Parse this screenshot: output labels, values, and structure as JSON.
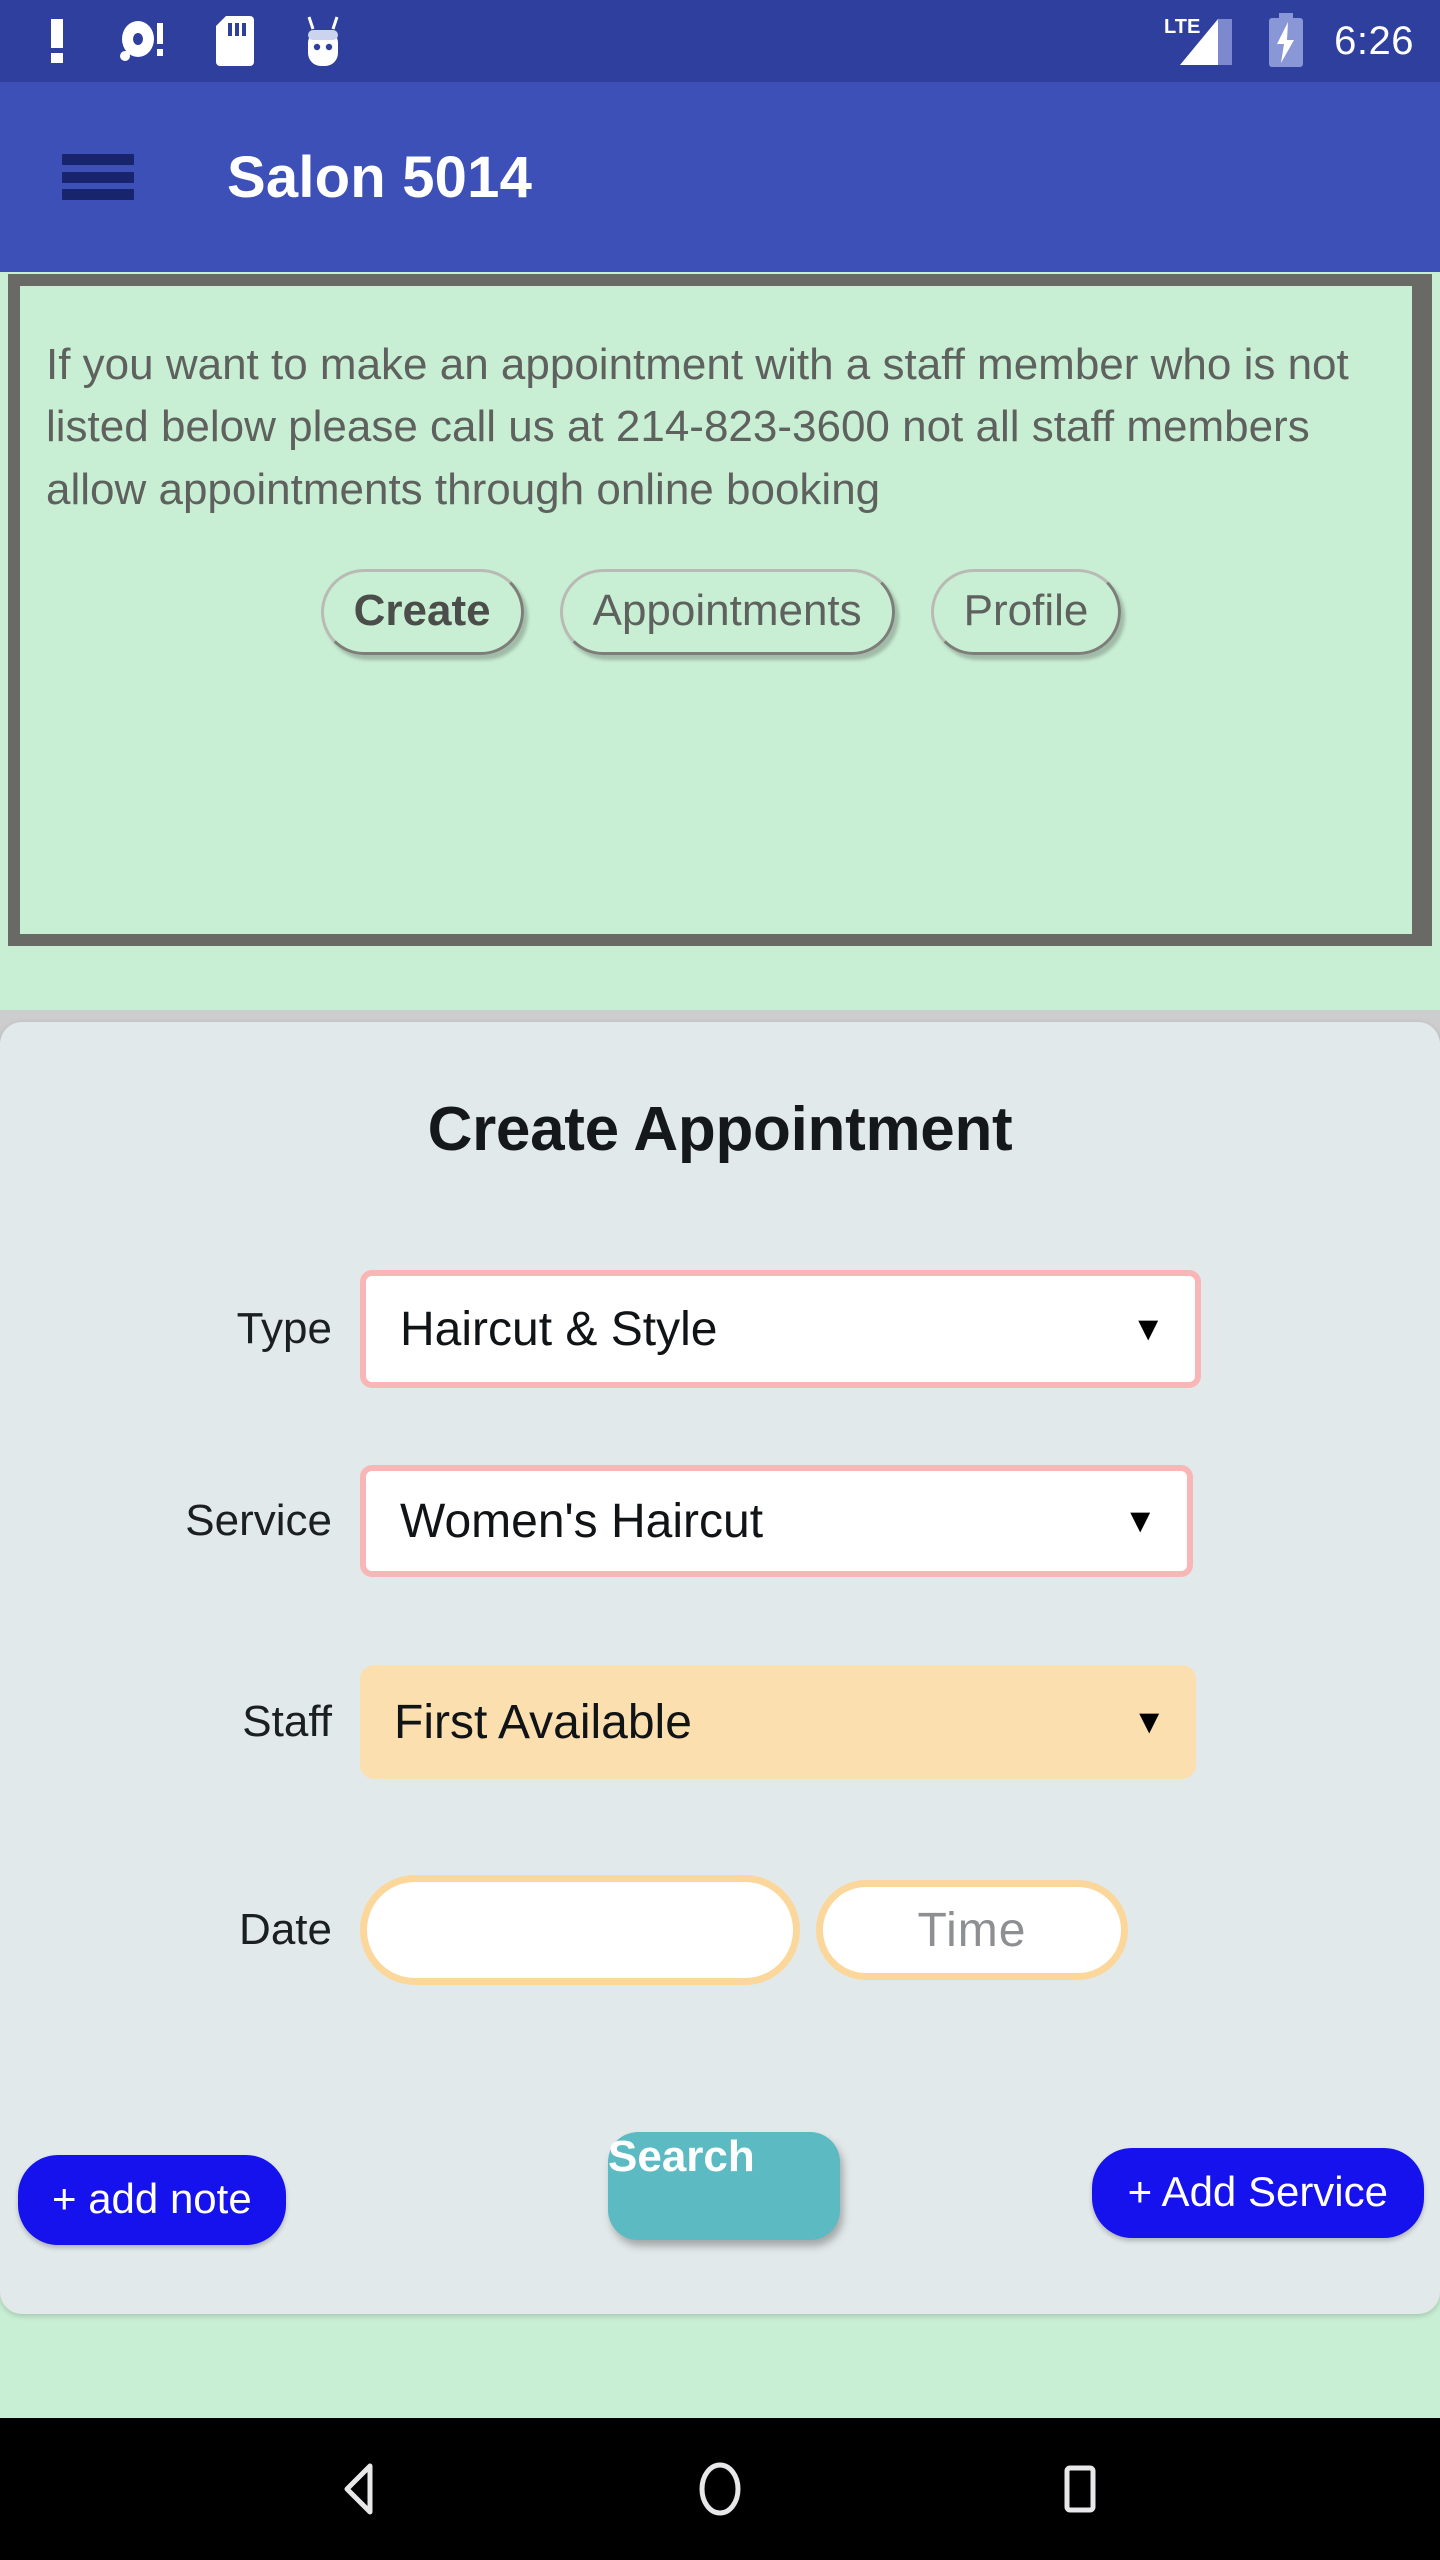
{
  "status_bar": {
    "time": "6:26",
    "network_label": "LTE",
    "icons": [
      "exclamation-notification-icon",
      "disc-notification-icon",
      "sd-card-icon",
      "android-robot-icon"
    ],
    "right_icons": [
      "lte-signal-icon",
      "battery-charging-icon"
    ],
    "background_color": "#2f3f9e"
  },
  "header": {
    "title": "Salon 5014",
    "menu_icon": "hamburger-menu-icon",
    "background_color": "#3c50b8",
    "title_color": "#ffffff"
  },
  "notice": {
    "text": "If you want to make an appointment with a staff member who is not listed below please call us at 214-823-3600 not all staff members allow appointments through online booking",
    "phone": "214-823-3600",
    "background_color": "#c8efd4",
    "border_color": "#696a66",
    "text_color": "#5f615e",
    "tabs": [
      {
        "label": "Create",
        "active": true
      },
      {
        "label": "Appointments",
        "active": false
      },
      {
        "label": "Profile",
        "active": false
      }
    ]
  },
  "form": {
    "title": "Create Appointment",
    "background_color": "#e2e9ea",
    "fields": {
      "type": {
        "label": "Type",
        "value": "Haircut & Style",
        "caret": "▼",
        "border_color": "#f9b6b6",
        "background_color": "#ffffff"
      },
      "service": {
        "label": "Service",
        "value": "Women's Haircut",
        "caret": "▼",
        "border_color": "#f9b6b6",
        "background_color": "#ffffff"
      },
      "staff": {
        "label": "Staff",
        "value": "First Available",
        "caret": "▼",
        "background_color": "#fcdfaf"
      },
      "date": {
        "label": "Date",
        "value": "",
        "placeholder": "",
        "border_color": "#fcd79c",
        "background_color": "#ffffff"
      },
      "time": {
        "value": "",
        "placeholder": "Time",
        "border_color": "#fcd79c",
        "background_color": "#ffffff",
        "placeholder_color": "#8d8f92"
      }
    },
    "actions": {
      "add_note": {
        "label": "+ add note",
        "color": "#1512ee"
      },
      "search": {
        "label": "Search",
        "color": "#5cbac2"
      },
      "add_service": {
        "label": "+ Add Service",
        "color": "#1512ee"
      }
    }
  },
  "nav_bar": {
    "background_color": "#000000",
    "buttons": [
      {
        "name": "back-icon"
      },
      {
        "name": "home-icon"
      },
      {
        "name": "recents-icon"
      }
    ]
  }
}
